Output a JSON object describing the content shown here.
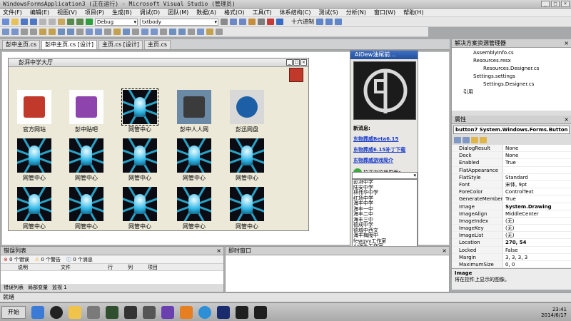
{
  "window": {
    "title": "WindowsFormsApplication3 (正在运行) - Microsoft Visual Studio (管理员)"
  },
  "menu": [
    "文件(F)",
    "编辑(E)",
    "视图(V)",
    "项目(P)",
    "生成(B)",
    "调试(D)",
    "团队(M)",
    "数据(A)",
    "格式(O)",
    "工具(T)",
    "体系结构(C)",
    "测试(S)",
    "分析(N)",
    "窗口(W)",
    "帮助(H)"
  ],
  "toolbar": {
    "config": "Debug",
    "target": "txtbody",
    "calc_label": "十六进制"
  },
  "doc_tabs": [
    "彭中主页.cs",
    "彭中主页.cs [设计]",
    "主页.cs [设计]",
    "主页.cs"
  ],
  "form": {
    "title": "彭湃中学大厅",
    "row1": [
      {
        "caption": "官方网站",
        "icon": "flag-logo-icon"
      },
      {
        "caption": "彭中贴吧",
        "icon": "tieba-logo-icon"
      },
      {
        "caption": "网管中心",
        "icon": "netcenter-icon"
      },
      {
        "caption": "彭中人人网",
        "icon": "building-photo-icon"
      },
      {
        "caption": "彭迅网盘",
        "icon": "globe-disk-icon"
      }
    ],
    "grid_caption": "网管中心"
  },
  "picture_panel": {
    "title": "AiDew油尾前...",
    "news_label": "新消息:",
    "links": [
      "东物葬威Beta6.15",
      "东物葬威6.15补丁下载",
      "东物葬威游戏简介"
    ],
    "browser_button": "拉开浏览器界面>",
    "list": [
      "彭湃中学",
      "陆安中学",
      "林伟华中学",
      "红场中学",
      "海丰中学",
      "海丰一中",
      "海丰二中",
      "海丰三中",
      "德成中学",
      "德城中西文",
      "海丰梅陇中",
      "fewgvy工作室",
      "小强头工作室"
    ]
  },
  "solution_explorer": {
    "title": "解决方案资源管理器",
    "items": [
      "AssemblyInfo.cs",
      "Resources.resx",
      "Resources.Designer.cs",
      "Settings.settings",
      "Settings.Designer.cs",
      "引用"
    ]
  },
  "properties": {
    "title": "属性",
    "object": "button7 System.Windows.Forms.Button",
    "rows": [
      [
        "DialogResult",
        "None"
      ],
      [
        "Dock",
        "None"
      ],
      [
        "Enabled",
        "True"
      ],
      [
        "FlatAppearance",
        ""
      ],
      [
        "FlatStyle",
        "Standard"
      ],
      [
        "Font",
        "宋体, 9pt"
      ],
      [
        "ForeColor",
        "ControlText"
      ],
      [
        "GenerateMember",
        "True"
      ],
      [
        "Image",
        "System.Drawing"
      ],
      [
        "ImageAlign",
        "MiddleCenter"
      ],
      [
        "ImageIndex",
        "(无)"
      ],
      [
        "ImageKey",
        "(无)"
      ],
      [
        "ImageList",
        "(无)"
      ],
      [
        "Location",
        "270, 54"
      ],
      [
        "Locked",
        "False"
      ],
      [
        "Margin",
        "3, 3, 3, 3"
      ],
      [
        "MaximumSize",
        "0, 0"
      ]
    ],
    "desc_title": "Image",
    "desc_text": "将在控件上显示的图像。"
  },
  "error_list": {
    "title": "错误列表",
    "counts": [
      "0 个错误",
      "0 个警告",
      "0 个消息"
    ],
    "columns": [
      "说明",
      "文件",
      "行",
      "列",
      "项目"
    ],
    "tabs": [
      "错误列表",
      "局部变量",
      "监视 1"
    ]
  },
  "output": {
    "title": "即时窗口"
  },
  "status": {
    "text": "就绪"
  },
  "taskbar": {
    "start": "开始",
    "time": "23:41",
    "date": "2014/6/17"
  }
}
